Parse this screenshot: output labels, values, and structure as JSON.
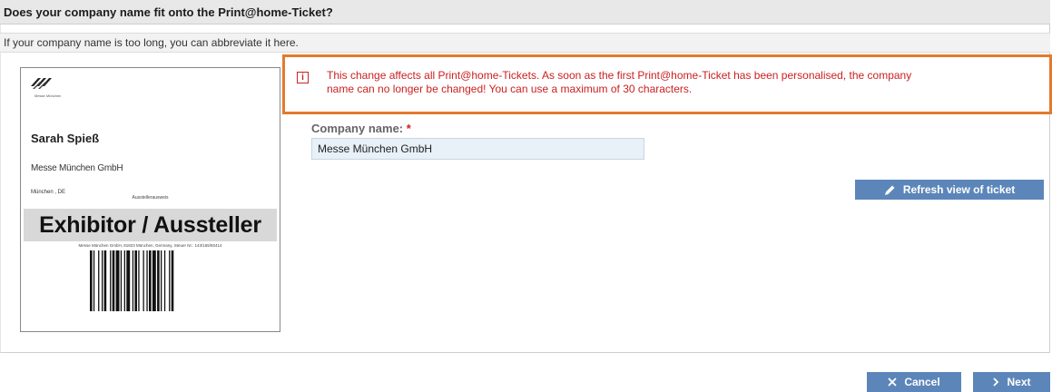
{
  "header": {
    "title": "Does your company name fit onto the Print@home-Ticket?"
  },
  "subheader": {
    "text": "If your company name is too long, you can abbreviate it here."
  },
  "notice": {
    "icon": "info-icon",
    "line1": "This change affects all Print@home-Tickets. As soon as the first Print@home-Ticket has been personalised, the company",
    "line2": "name can no longer be changed! You can use a maximum of 30 characters."
  },
  "ticket": {
    "logo_caption": "Messe München",
    "name": "Sarah Spieß",
    "company": "Messe München GmbH",
    "city": "München , DE",
    "pass_label": "Ausstellerausweis",
    "banner": "Exhibitor / Aussteller",
    "address": "Messe München GmbH, 81823 München, Germany, Steuer Nr.: 143/165/50414"
  },
  "form": {
    "company_label": "Company name:",
    "required_marker": "*",
    "company_value": "Messe München GmbH"
  },
  "buttons": {
    "refresh": "Refresh view of ticket",
    "cancel": "Cancel",
    "next": "Next"
  },
  "colors": {
    "accent": "#5c86b9",
    "notice_border": "#e37a2d",
    "notice_text": "#cc1f1f"
  }
}
